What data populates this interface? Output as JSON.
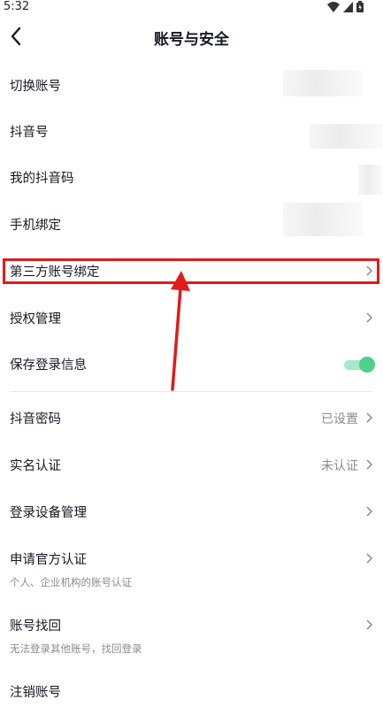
{
  "status_bar": {
    "time": "5:32",
    "icons": [
      "wifi-icon",
      "signal-icon",
      "battery-icon"
    ]
  },
  "header": {
    "title": "账号与安全",
    "back_icon": "chevron-left-icon"
  },
  "rows": {
    "switch_account": {
      "label": "切换账号"
    },
    "douyin_id": {
      "label": "抖音号"
    },
    "my_code": {
      "label": "我的抖音码"
    },
    "phone_binding": {
      "label": "手机绑定"
    },
    "third_party_binding": {
      "label": "第三方账号绑定"
    },
    "authorization": {
      "label": "授权管理"
    },
    "save_login": {
      "label": "保存登录信息",
      "toggle_on": true
    },
    "password": {
      "label": "抖音密码",
      "value": "已设置"
    },
    "real_name": {
      "label": "实名认证",
      "value": "未认证"
    },
    "device_manage": {
      "label": "登录设备管理"
    },
    "official_verify": {
      "label": "申请官方认证",
      "sub": "个人、企业机构的账号认证"
    },
    "account_recovery": {
      "label": "账号找回",
      "sub": "无法登录其他账号，找回登录"
    },
    "cancel_account": {
      "label": "注销账号"
    }
  },
  "colors": {
    "accent_green": "#4cd08a",
    "highlight_red": "#e21a1a",
    "text_primary": "#161823",
    "text_secondary": "#8a8b91"
  }
}
